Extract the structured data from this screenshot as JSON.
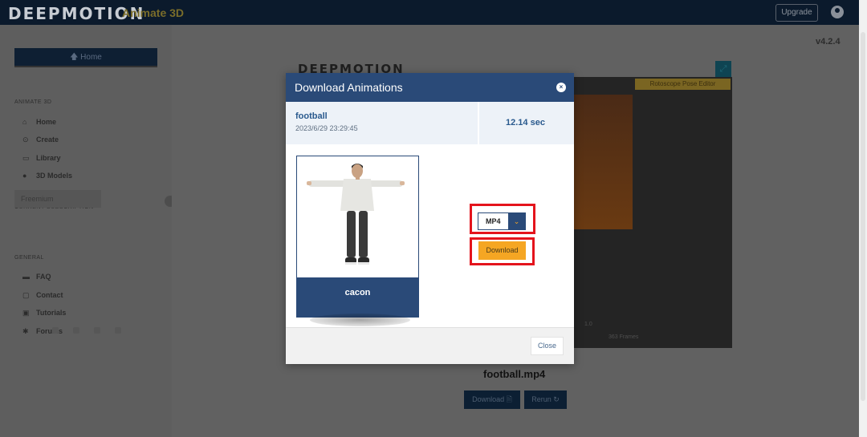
{
  "app": {
    "brand": "DEEPMOTION",
    "product": "Animate 3D",
    "version": "v4.2.4",
    "upgrade_label": "Upgrade"
  },
  "sidebar": {
    "home_button": "🡅 Home",
    "sections": [
      {
        "title": "ANIMATE 3D",
        "items": [
          {
            "label": "Home",
            "icon": "home-icon",
            "glyph": "⌂"
          },
          {
            "label": "Create",
            "icon": "create-icon",
            "glyph": "⊙"
          },
          {
            "label": "Library",
            "icon": "folder-icon",
            "glyph": "▭"
          },
          {
            "label": "3D Models",
            "icon": "users-icon",
            "glyph": "●"
          }
        ]
      },
      {
        "title": "CURRENT SUBSCRIPTION",
        "plan": "Freemium"
      },
      {
        "title": "GENERAL",
        "items": [
          {
            "label": "FAQ",
            "icon": "book-icon",
            "glyph": "▬"
          },
          {
            "label": "Contact",
            "icon": "chat-icon",
            "glyph": "▢"
          },
          {
            "label": "Tutorials",
            "icon": "video-icon",
            "glyph": "▣"
          },
          {
            "label": "Forums",
            "icon": "forum-icon",
            "glyph": "✱"
          }
        ]
      }
    ]
  },
  "background": {
    "logo": "DEEPMOTION",
    "rotoscope_label": "Rotoscope Pose Editor",
    "speed": "1.0",
    "frames": "363 Frames",
    "filename": "football.mp4",
    "download_label": "Download 🗎",
    "rerun_label": "Rerun ↻"
  },
  "modal": {
    "title": "Download Animations",
    "close_x": "×",
    "animation_name": "football",
    "animation_date": "2023/6/29 23:29:45",
    "duration": "12.14 sec",
    "model_name": "cacon",
    "format_selected": "MP4",
    "format_options": [
      "MP4"
    ],
    "download_label": "Download",
    "close_label": "Close"
  },
  "colors": {
    "header_blue": "#2a4a78",
    "accent_orange": "#f5a623",
    "highlight_red": "#e4141c"
  }
}
